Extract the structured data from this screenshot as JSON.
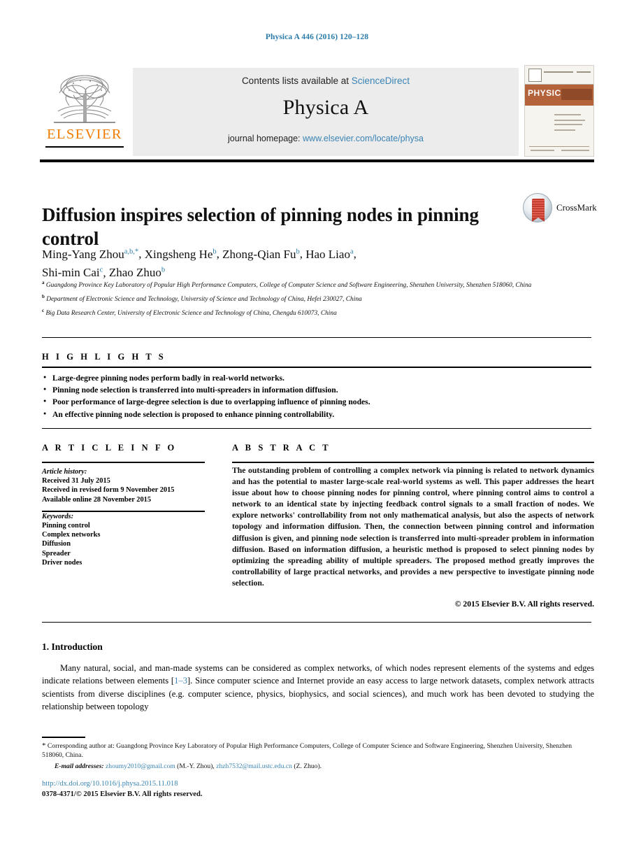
{
  "running_head": "Physica A 446 (2016) 120–128",
  "masthead": {
    "contents_prefix": "Contents lists available at ",
    "sciencedirect": "ScienceDirect",
    "journal_title": "Physica A",
    "homepage_prefix": "journal homepage: ",
    "homepage_url": "www.elsevier.com/locate/physa",
    "publisher_wordmark": "ELSEVIER",
    "cover_title": "PHYSICA",
    "logo_icon": "elsevier-tree-icon"
  },
  "article": {
    "title": "Diffusion inspires selection of pinning nodes in pinning control",
    "crossmark_label": "CrossMark",
    "authors_line1": "Ming-Yang Zhou ",
    "authors": [
      {
        "name": "Ming-Yang Zhou",
        "marks": "a,b,*"
      },
      {
        "name": "Xingsheng He",
        "marks": "b"
      },
      {
        "name": "Zhong-Qian Fu",
        "marks": "b"
      },
      {
        "name": "Hao Liao",
        "marks": "a"
      },
      {
        "name": "Shi-min Cai",
        "marks": "c"
      },
      {
        "name": "Zhao Zhuo",
        "marks": "b"
      }
    ],
    "affiliations": [
      {
        "mark": "a",
        "text": "Guangdong Province Key Laboratory of Popular High Performance Computers, College of Computer Science and Software Engineering, Shenzhen University, Shenzhen 518060, China"
      },
      {
        "mark": "b",
        "text": "Department of Electronic Science and Technology, University of Science and Technology of China, Hefei 230027, China"
      },
      {
        "mark": "c",
        "text": "Big Data Research Center, University of Electronic Science and Technology of China, Chengdu 610073, China"
      }
    ]
  },
  "highlights": {
    "heading": "H I G H L I G H T S",
    "items": [
      "Large-degree pinning nodes perform badly in real-world networks.",
      "Pinning node selection is transferred into multi-spreaders in information diffusion.",
      "Poor performance of large-degree selection is due to overlapping influence of pinning nodes.",
      "An effective pinning node selection is proposed to enhance pinning controllability."
    ]
  },
  "article_info": {
    "heading": "A R T I C L E   I N F O",
    "history_label": "Article history:",
    "history": [
      "Received 31 July 2015",
      "Received in revised form 9 November 2015",
      "Available online 28 November 2015"
    ],
    "keywords_label": "Keywords:",
    "keywords": [
      "Pinning control",
      "Complex networks",
      "Diffusion",
      "Spreader",
      "Driver nodes"
    ]
  },
  "abstract": {
    "heading": "A B S T R A C T",
    "text": "The outstanding problem of controlling a complex network via pinning is related to network dynamics and has the potential to master large-scale real-world systems as well. This paper addresses the heart issue about how to choose pinning nodes for pinning control, where pinning control aims to control a network to an identical state by injecting feedback control signals to a small fraction of nodes. We explore networks' controllability from not only mathematical analysis, but also the aspects of network topology and information diffusion. Then, the connection between pinning control and information diffusion is given, and pinning node selection is transferred into multi-spreader problem in information diffusion. Based on information diffusion, a heuristic method is proposed to select pinning nodes by optimizing the spreading ability of multiple spreaders. The proposed method greatly improves the controllability of large practical networks, and provides a new perspective to investigate pinning node selection.",
    "copyright": "© 2015 Elsevier B.V. All rights reserved."
  },
  "introduction": {
    "heading": "1. Introduction",
    "paragraph_part1": "Many natural, social, and man-made systems can be considered as complex networks, of which nodes represent elements of the systems and edges indicate relations between elements [",
    "reference": "1–3",
    "paragraph_part2": "]. Since computer science and Internet provide an easy access to large network datasets, complex network attracts scientists from diverse disciplines (e.g. computer science, physics, biophysics, and social sciences), and much work has been devoted to studying the relationship between topology"
  },
  "footnote": {
    "corresponding": "Corresponding author at: Guangdong Province Key Laboratory of Popular High Performance Computers, College of Computer Science and Software Engineering, Shenzhen University, Shenzhen 518060, China.",
    "emails_label": "E-mail addresses:",
    "email1": "zhoumy2010@gmail.com",
    "email1_author": "(M.-Y. Zhou),",
    "email2": "zhzh7532@mail.ustc.edu.cn",
    "email2_author": "(Z. Zhuo)."
  },
  "footer": {
    "doi": "http://dx.doi.org/10.1016/j.physa.2015.11.018",
    "issn": "0378-4371/© 2015 Elsevier B.V. All rights reserved."
  },
  "colors": {
    "link_blue": "#3a84b5",
    "running_head_blue": "#2b7ba8",
    "elsevier_orange": "#f07c00",
    "band_grey": "#ececec"
  }
}
